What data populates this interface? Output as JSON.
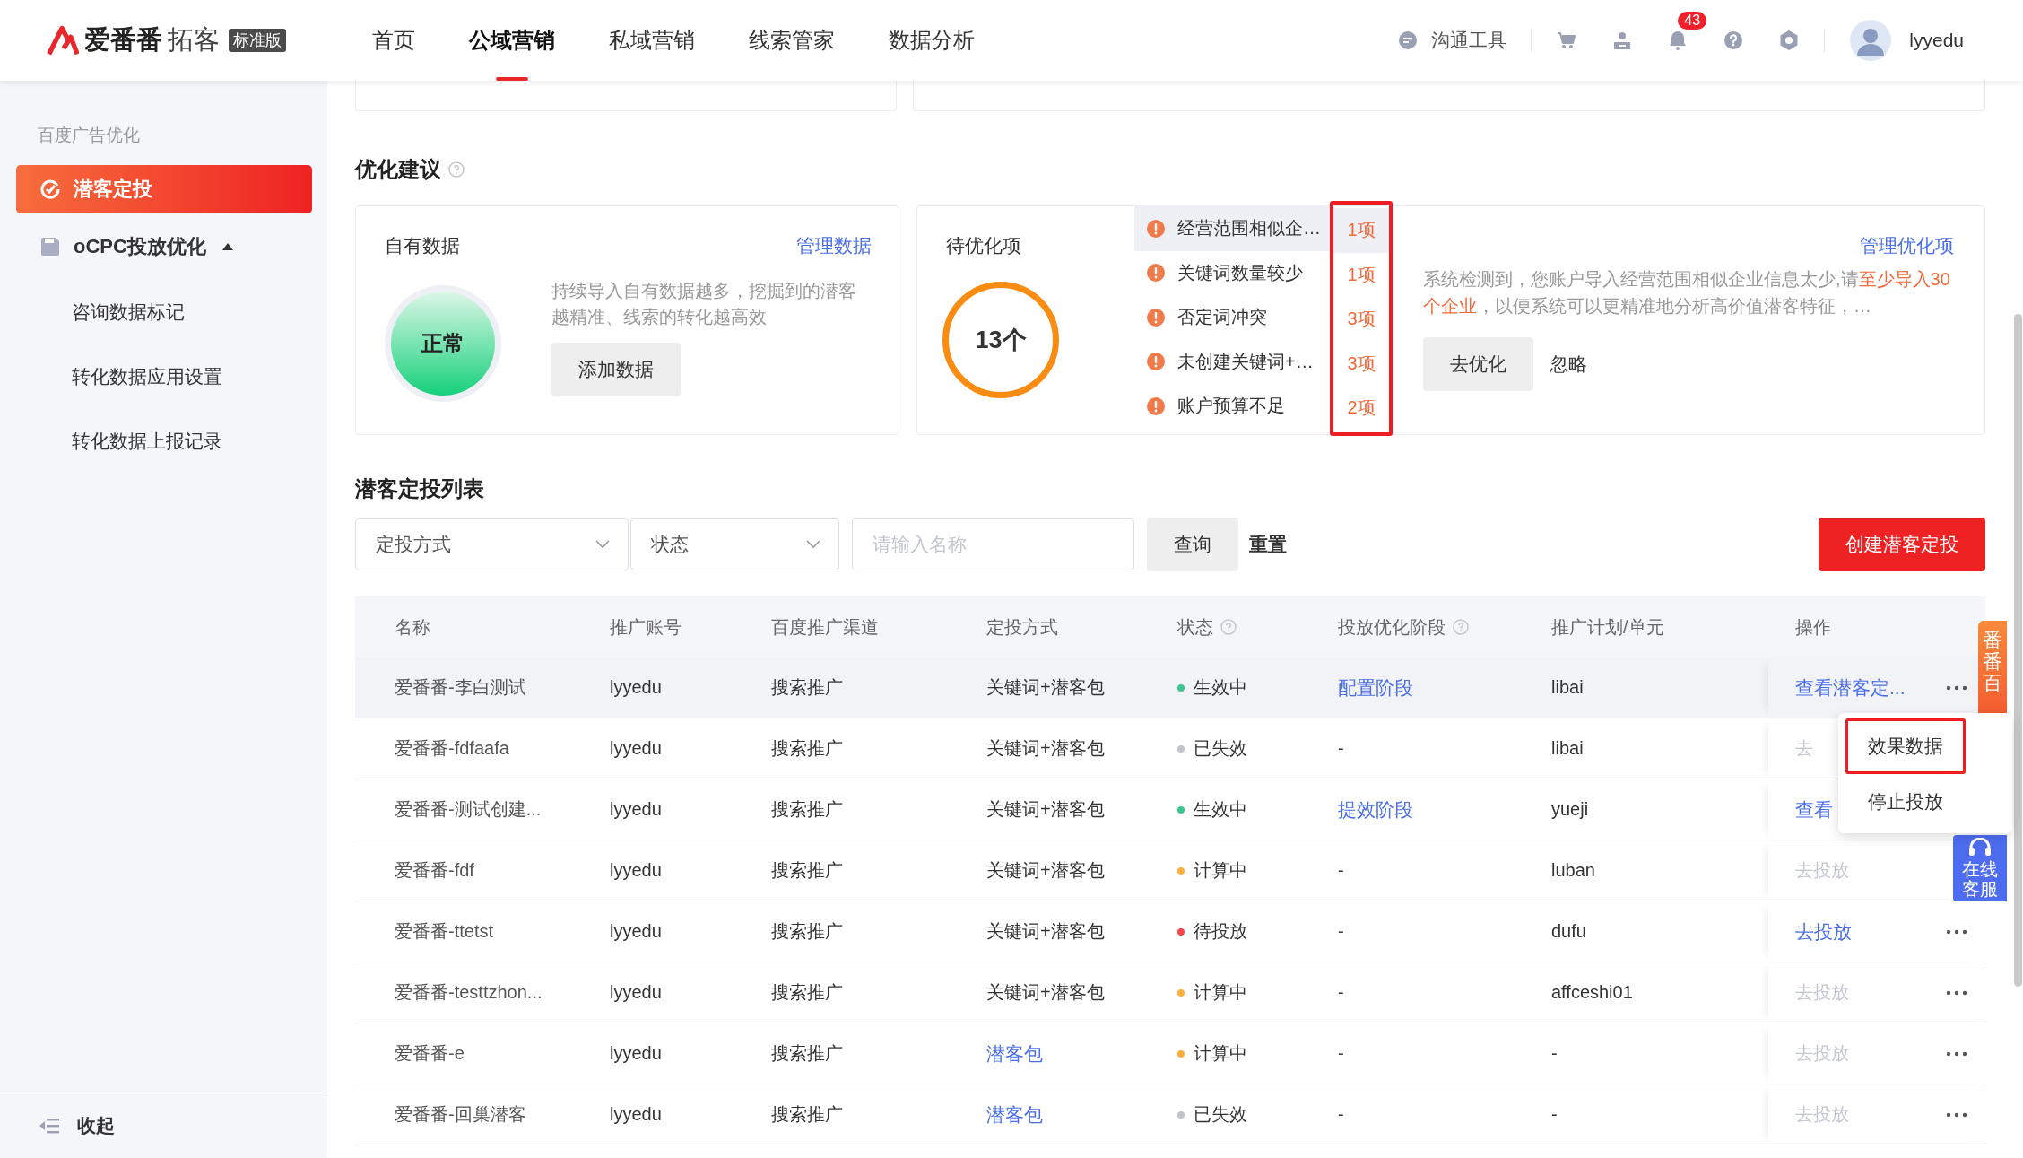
{
  "header": {
    "logo": {
      "brand": "爱番番",
      "product": "拓客",
      "edition": "标准版"
    },
    "nav": [
      {
        "label": "首页",
        "selected": false
      },
      {
        "label": "公域营销",
        "selected": true
      },
      {
        "label": "私域营销",
        "selected": false
      },
      {
        "label": "线索管家",
        "selected": false
      },
      {
        "label": "数据分析",
        "selected": false
      }
    ],
    "tools": [
      {
        "kind": "chat",
        "label": "沟通工具"
      },
      {
        "kind": "cart"
      },
      {
        "kind": "contact"
      },
      {
        "kind": "bell",
        "badge": "43"
      },
      {
        "kind": "help"
      },
      {
        "kind": "settings"
      }
    ],
    "user": {
      "name": "lyyedu"
    }
  },
  "sidebar": {
    "group": "百度广告优化",
    "items": [
      {
        "kind": "page",
        "label": "潜客定投",
        "selected": true
      },
      {
        "kind": "group",
        "label": "oCPC投放优化",
        "selected": false,
        "expanded": true,
        "children": [
          {
            "label": "咨询数据标记",
            "selected": false
          },
          {
            "label": "转化数据应用设置",
            "selected": false
          },
          {
            "label": "转化数据上报记录",
            "selected": false
          }
        ]
      }
    ],
    "collapse": "收起"
  },
  "optimization": {
    "title": "优化建议",
    "own_data": {
      "title": "自有数据",
      "link": "管理数据",
      "status": "正常",
      "description": "持续导入自有数据越多，挖掘到的潜客越精准、线索的转化越高效",
      "button": "添加数据"
    },
    "pending": {
      "title": "待优化项",
      "total": "13个",
      "counts_highlighted": true,
      "items": [
        {
          "label": "经营范围相似企…",
          "count": "1项",
          "hovered": true
        },
        {
          "label": "关键词数量较少",
          "count": "1项",
          "hovered": false
        },
        {
          "label": "否定词冲突",
          "count": "3项",
          "hovered": false
        },
        {
          "label": "未创建关键词+…",
          "count": "3项",
          "hovered": false
        },
        {
          "label": "账户预算不足",
          "count": "2项",
          "hovered": false
        }
      ],
      "link": "管理优化项",
      "detail": [
        {
          "text": "系统检测到，您账户导入经营范围相似企业信息太少,请",
          "emphasis": false
        },
        {
          "text": "至少导入30个企业",
          "emphasis": true
        },
        {
          "text": "，以便系统可以更精准地分析高价值潜客特征，…",
          "emphasis": false
        }
      ],
      "buttons": [
        {
          "kind": "filled",
          "label": "去优化"
        },
        {
          "kind": "text",
          "label": "忽略"
        }
      ]
    }
  },
  "campaigns": {
    "title": "潜客定投列表",
    "filters": [
      {
        "kind": "select",
        "placeholder": "定投方式"
      },
      {
        "kind": "select",
        "placeholder": "状态"
      },
      {
        "kind": "input",
        "placeholder": "请输入名称"
      }
    ],
    "query": "查询",
    "reset": "重置",
    "create": "创建潜客定投",
    "table": {
      "columns": [
        {
          "label": "名称",
          "help": false
        },
        {
          "label": "推广账号",
          "help": false
        },
        {
          "label": "百度推广渠道",
          "help": false
        },
        {
          "label": "定投方式",
          "help": false
        },
        {
          "label": "状态",
          "help": true
        },
        {
          "label": "投放优化阶段",
          "help": true
        },
        {
          "label": "推广计划/单元",
          "help": false
        },
        {
          "label": "操作",
          "help": false
        }
      ],
      "rows": [
        {
          "name": "爱番番-李白测试",
          "account": "lyyedu",
          "channel": "搜索推广",
          "method": {
            "text": "关键词+潜客包",
            "link": false
          },
          "status": {
            "text": "生效中",
            "color": "#3ec48f"
          },
          "stage": {
            "text": "配置阶段",
            "link": true
          },
          "plan": "libai",
          "action": {
            "text": "查看潜客定...",
            "enabled": true
          },
          "more": true,
          "hovered": true
        },
        {
          "name": "爱番番-fdfaafa",
          "account": "lyyedu",
          "channel": "搜索推广",
          "method": {
            "text": "关键词+潜客包",
            "link": false
          },
          "status": {
            "text": "已失效",
            "color": "#c0c4cc"
          },
          "stage": {
            "text": "-",
            "link": false
          },
          "plan": "libai",
          "action": {
            "text": "去",
            "enabled": false
          },
          "hovered": false
        },
        {
          "name": "爱番番-测试创建...",
          "account": "lyyedu",
          "channel": "搜索推广",
          "method": {
            "text": "关键词+潜客包",
            "link": false
          },
          "status": {
            "text": "生效中",
            "color": "#3ec48f"
          },
          "stage": {
            "text": "提效阶段",
            "link": true
          },
          "plan": "yueji",
          "action": {
            "text": "查看",
            "enabled": true
          },
          "hovered": false
        },
        {
          "name": "爱番番-fdf",
          "account": "lyyedu",
          "channel": "搜索推广",
          "method": {
            "text": "关键词+潜客包",
            "link": false
          },
          "status": {
            "text": "计算中",
            "color": "#ffae3d"
          },
          "stage": {
            "text": "-",
            "link": false
          },
          "plan": "luban",
          "action": {
            "text": "去投放",
            "enabled": false
          },
          "more": false,
          "hovered": false
        },
        {
          "name": "爱番番-ttetst",
          "account": "lyyedu",
          "channel": "搜索推广",
          "method": {
            "text": "关键词+潜客包",
            "link": false
          },
          "status": {
            "text": "待投放",
            "color": "#f5474b"
          },
          "stage": {
            "text": "-",
            "link": false
          },
          "plan": "dufu",
          "action": {
            "text": "去投放",
            "enabled": true
          },
          "more": true,
          "hovered": false
        },
        {
          "name": "爱番番-testtzhon...",
          "account": "lyyedu",
          "channel": "搜索推广",
          "method": {
            "text": "关键词+潜客包",
            "link": false
          },
          "status": {
            "text": "计算中",
            "color": "#ffae3d"
          },
          "stage": {
            "text": "-",
            "link": false
          },
          "plan": "affceshi01",
          "action": {
            "text": "去投放",
            "enabled": false
          },
          "more": true,
          "hovered": false
        },
        {
          "name": "爱番番-e",
          "account": "lyyedu",
          "channel": "搜索推广",
          "method": {
            "text": "潜客包",
            "link": true
          },
          "status": {
            "text": "计算中",
            "color": "#ffae3d"
          },
          "stage": {
            "text": "-",
            "link": false
          },
          "plan": "-",
          "action": {
            "text": "去投放",
            "enabled": false
          },
          "more": true,
          "hovered": false
        },
        {
          "name": "爱番番-回巢潜客",
          "account": "lyyedu",
          "channel": "搜索推广",
          "method": {
            "text": "潜客包",
            "link": true
          },
          "status": {
            "text": "已失效",
            "color": "#c0c4cc"
          },
          "stage": {
            "text": "-",
            "link": false
          },
          "plan": "-",
          "action": {
            "text": "去投放",
            "enabled": false
          },
          "more": true,
          "hovered": false
        }
      ]
    },
    "menu": {
      "items": [
        {
          "label": "效果数据",
          "highlighted": true
        },
        {
          "label": "停止投放",
          "highlighted": false
        }
      ]
    }
  },
  "side_tabs": [
    {
      "kind": "toolbox",
      "label": "番番百"
    },
    {
      "kind": "service",
      "label": "在线客服"
    }
  ]
}
